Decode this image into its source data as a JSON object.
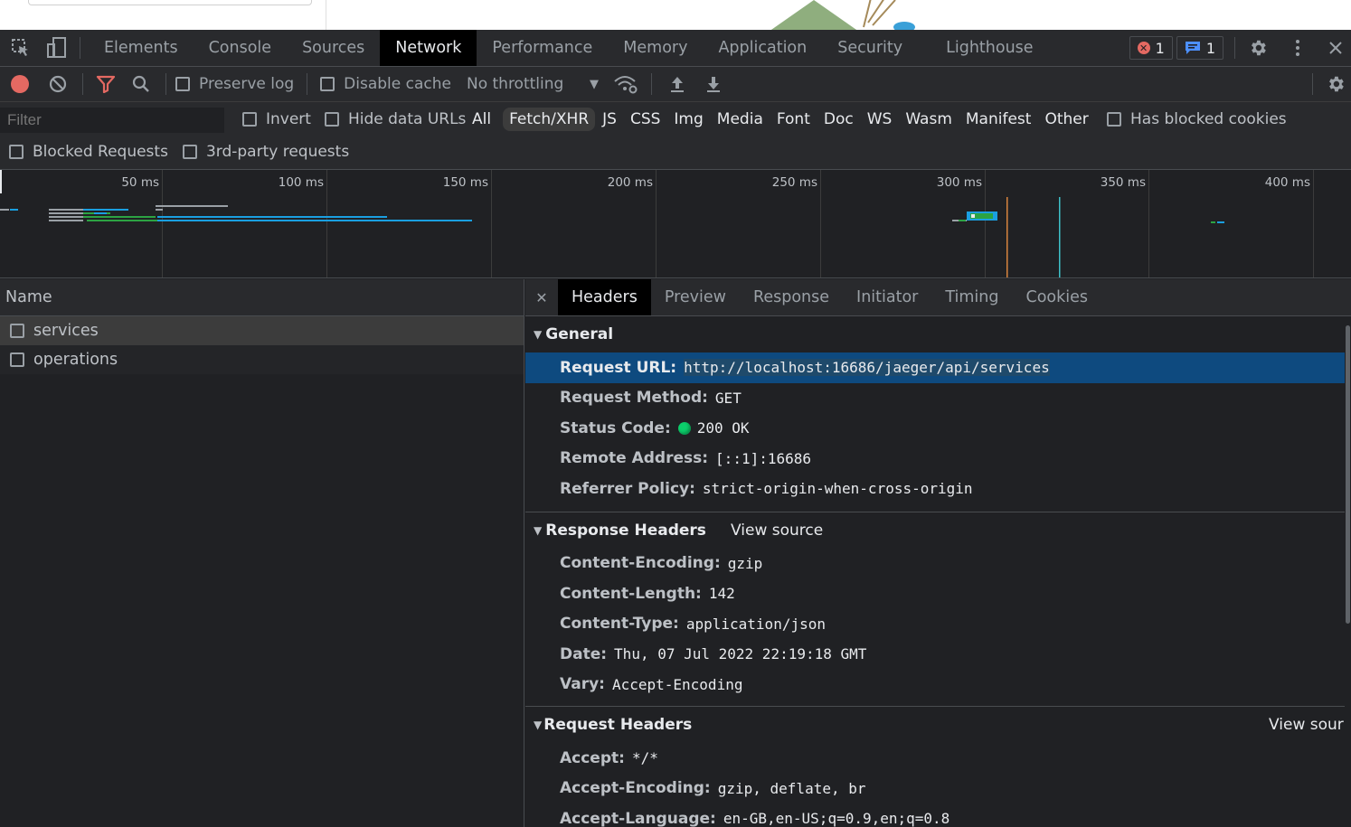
{
  "tabs": {
    "items": [
      "Elements",
      "Console",
      "Sources",
      "Network",
      "Performance",
      "Memory",
      "Application",
      "Security",
      "Lighthouse"
    ],
    "active": "Network",
    "error_count": "1",
    "message_count": "1"
  },
  "toolbar": {
    "preserve_log": "Preserve log",
    "disable_cache": "Disable cache",
    "throttling": "No throttling"
  },
  "filter": {
    "placeholder": "Filter",
    "invert": "Invert",
    "hide_data_urls": "Hide data URLs",
    "types": [
      "All",
      "Fetch/XHR",
      "JS",
      "CSS",
      "Img",
      "Media",
      "Font",
      "Doc",
      "WS",
      "Wasm",
      "Manifest",
      "Other"
    ],
    "active_type": "Fetch/XHR",
    "has_blocked_cookies": "Has blocked cookies",
    "blocked_requests": "Blocked Requests",
    "third_party": "3rd-party requests"
  },
  "timeline": {
    "ticks": [
      "50 ms",
      "100 ms",
      "150 ms",
      "200 ms",
      "250 ms",
      "300 ms",
      "350 ms",
      "400 ms"
    ]
  },
  "requests": {
    "header": "Name",
    "items": [
      "services",
      "operations"
    ]
  },
  "details": {
    "tabs": [
      "Headers",
      "Preview",
      "Response",
      "Initiator",
      "Timing",
      "Cookies"
    ],
    "active_tab": "Headers",
    "general": {
      "title": "General",
      "rows": [
        {
          "key": "Request URL:",
          "value": "http://localhost:16686/jaeger/api/services"
        },
        {
          "key": "Request Method:",
          "value": "GET"
        },
        {
          "key": "Status Code:",
          "value": "200 OK"
        },
        {
          "key": "Remote Address:",
          "value": "[::1]:16686"
        },
        {
          "key": "Referrer Policy:",
          "value": "strict-origin-when-cross-origin"
        }
      ]
    },
    "response_headers": {
      "title": "Response Headers",
      "view_source": "View source",
      "rows": [
        {
          "key": "Content-Encoding:",
          "value": "gzip"
        },
        {
          "key": "Content-Length:",
          "value": "142"
        },
        {
          "key": "Content-Type:",
          "value": "application/json"
        },
        {
          "key": "Date:",
          "value": "Thu, 07 Jul 2022 22:19:18 GMT"
        },
        {
          "key": "Vary:",
          "value": "Accept-Encoding"
        }
      ]
    },
    "request_headers": {
      "title": "Request Headers",
      "view_source": "View sour",
      "rows": [
        {
          "key": "Accept:",
          "value": "*/*"
        },
        {
          "key": "Accept-Encoding:",
          "value": "gzip, deflate, br"
        },
        {
          "key": "Accept-Language:",
          "value": "en-GB,en-US;q=0.9,en;q=0.8"
        }
      ]
    }
  },
  "icons": {
    "inspect": "inspect-element-icon",
    "device": "device-toolbar-icon",
    "record": "record-icon",
    "clear": "clear-icon",
    "filter": "filter-icon",
    "search": "search-icon",
    "network_conditions": "network-conditions-icon",
    "upload": "import-har-icon",
    "download": "export-har-icon",
    "settings": "gear-icon",
    "more": "more-vertical-icon",
    "close": "close-icon"
  },
  "colors": {
    "record": "#e46962",
    "filter_active": "#e46962",
    "selected_row": "#0e4a7f",
    "status_ok": "#0cce6b",
    "active_tab": "#000000"
  }
}
